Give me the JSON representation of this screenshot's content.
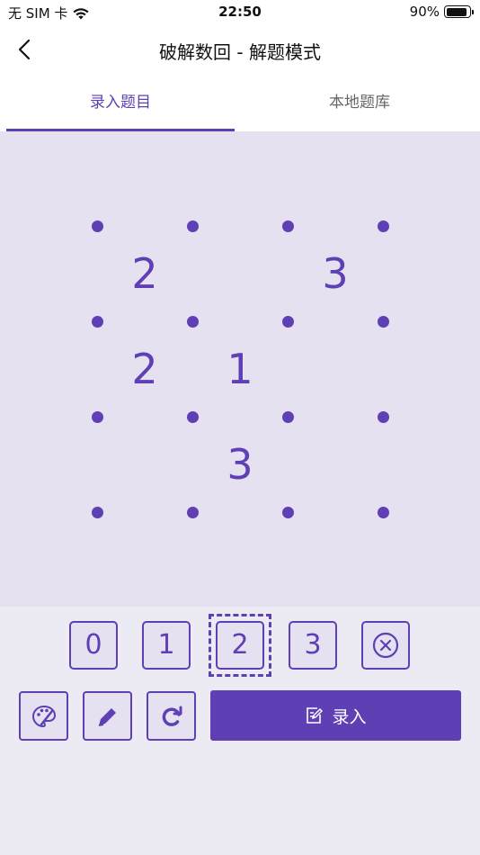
{
  "status_bar": {
    "carrier": "无 SIM 卡",
    "time": "22:50",
    "battery_text": "90%",
    "battery_level": 0.9
  },
  "nav": {
    "title": "破解数回 - 解题模式"
  },
  "tabs": [
    {
      "label": "录入题目",
      "active": true
    },
    {
      "label": "本地题库",
      "active": false
    }
  ],
  "board": {
    "dot_rows": 4,
    "dot_cols": 4,
    "cells": [
      [
        "2",
        "",
        "3"
      ],
      [
        "2",
        "1",
        ""
      ],
      [
        "",
        "3",
        ""
      ]
    ]
  },
  "keypad": {
    "keys": [
      "0",
      "1",
      "2",
      "3"
    ],
    "selected": "2",
    "clear_icon": "circle-x-icon"
  },
  "tools": {
    "icons": [
      "palette-icon",
      "pencil-icon",
      "refresh-icon"
    ],
    "submit_label": "录入",
    "submit_icon": "edit-note-icon"
  },
  "colors": {
    "accent": "#5e3fb4",
    "board_bg": "#e5e1f0",
    "page_bg": "#ecebf3"
  }
}
